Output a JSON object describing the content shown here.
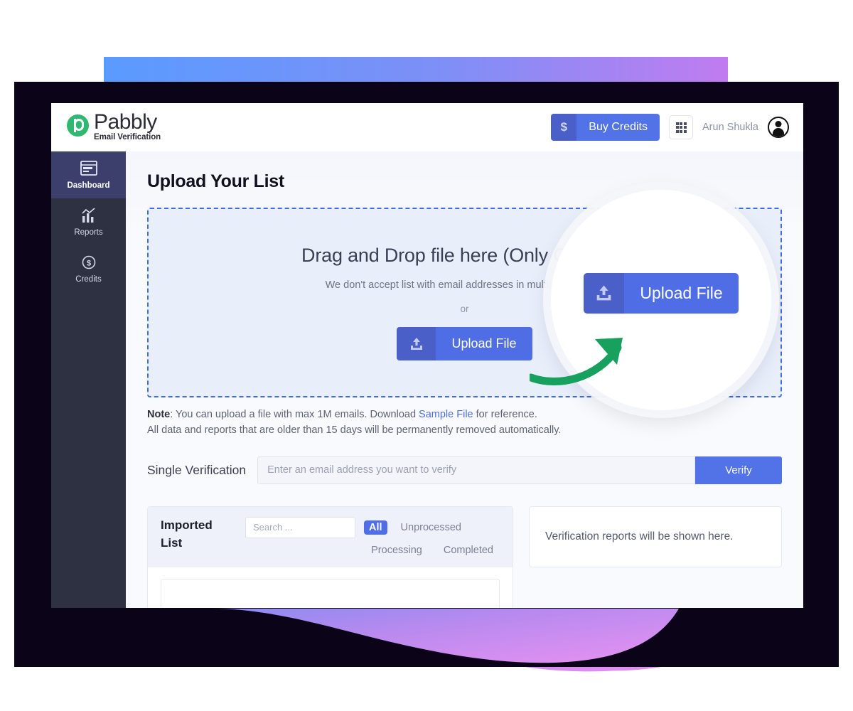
{
  "brand": {
    "name": "Pabbly",
    "subtitle": "Email Verification",
    "logo_icon": "pabbly-p-logo-icon"
  },
  "header": {
    "buy_credits_label": "Buy Credits",
    "buy_credits_icon": "dollar-icon",
    "apps_icon": "grid-apps-icon",
    "user_name": "Arun Shukla",
    "avatar_icon": "user-avatar-icon"
  },
  "sidebar": {
    "items": [
      {
        "label": "Dashboard",
        "icon": "dashboard-window-icon",
        "active": true
      },
      {
        "label": "Reports",
        "icon": "bar-chart-icon",
        "active": false
      },
      {
        "label": "Credits",
        "icon": "dollar-coin-icon",
        "active": false
      }
    ]
  },
  "main": {
    "page_title": "Upload Your List",
    "dropzone": {
      "title": "Drag and Drop file here (Only CSV file)",
      "subtitle": "We don't accept list with email addresses in multiple columns",
      "or_label": "or",
      "upload_button_label": "Upload File",
      "upload_button_icon": "upload-icon"
    },
    "note": {
      "prefix": "Note",
      "line1_before_link": ": You can upload a file with max 1M emails. Download ",
      "link_text": "Sample File",
      "line1_after_link": " for reference.",
      "line2": "All data and reports that are older than 15 days will be permanently removed automatically."
    },
    "single_verification": {
      "label": "Single Verification",
      "input_placeholder": "Enter an email address you want to verify",
      "input_value": "",
      "verify_button_label": "Verify"
    },
    "imported_list": {
      "title": "Imported List",
      "search_placeholder": "Search ...",
      "search_value": "",
      "filters": [
        {
          "label": "All",
          "active": true
        },
        {
          "label": "Unprocessed",
          "active": false
        },
        {
          "label": "Processing",
          "active": false
        },
        {
          "label": "Completed",
          "active": false
        }
      ]
    },
    "reports_panel": {
      "empty_text": "Verification reports will be shown here."
    }
  },
  "callout": {
    "magnified_button_label": "Upload File",
    "magnified_button_icon": "upload-icon",
    "arrow_icon": "curved-arrow-icon",
    "arrow_color": "#18a05e"
  },
  "colors": {
    "primary_blue": "#4f6ee6",
    "primary_blue_dark": "#4a5fc7",
    "sidebar_bg": "#2e3142",
    "sidebar_active": "#3c3f6b",
    "frame_dark": "#0b0317",
    "brand_green": "#2eb872",
    "dropzone_bg": "#e9eefb",
    "dropzone_border": "#3f6ee0",
    "gradient_blue": "#5a9bff",
    "gradient_purple": "#c07cf0"
  }
}
